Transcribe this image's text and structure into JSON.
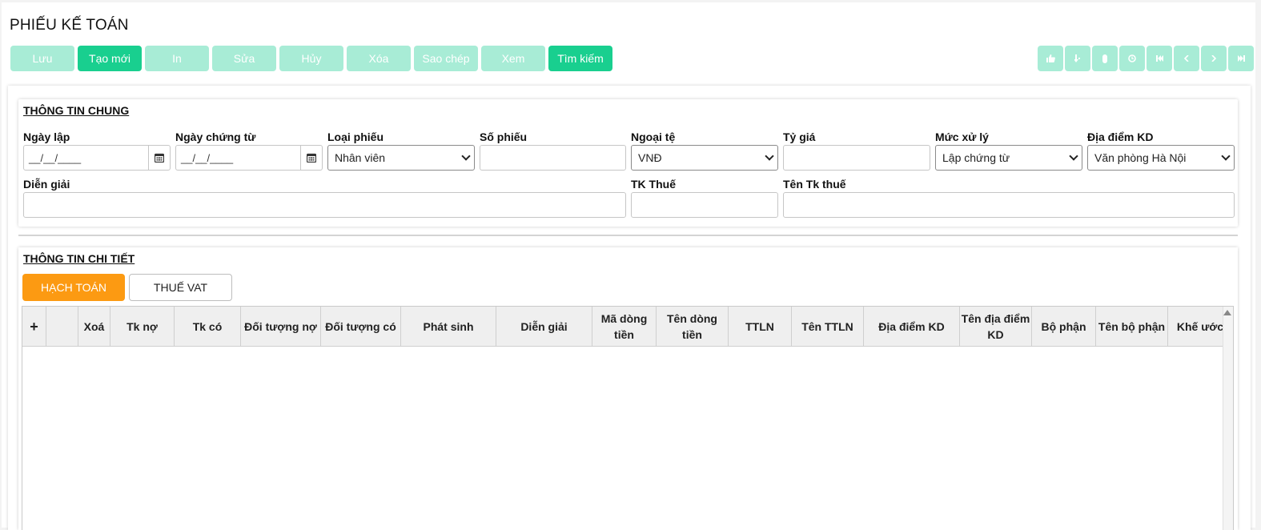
{
  "title": "PHIẾU KẾ TOÁN",
  "toolbar": {
    "save": "Lưu",
    "create": "Tạo mới",
    "print": "In",
    "edit": "Sửa",
    "cancel": "Hủy",
    "delete": "Xóa",
    "copy": "Sao chép",
    "view": "Xem",
    "search": "Tìm kiếm"
  },
  "nav_icons": [
    "thumbs-up-icon",
    "sort-icon",
    "paperclip-icon",
    "history-icon",
    "first-page-icon",
    "prev-icon",
    "next-icon",
    "last-page-icon"
  ],
  "general": {
    "title": "THÔNG TIN CHUNG",
    "date_created_label": "Ngày lập",
    "date_created_placeholder": "__/__/____",
    "doc_date_label": "Ngày chứng từ",
    "doc_date_placeholder": "__/__/____",
    "voucher_type_label": "Loại phiếu",
    "voucher_type_value": "Nhân viên",
    "voucher_no_label": "Số phiếu",
    "voucher_no_value": "",
    "currency_label": "Ngoại tệ",
    "currency_value": "VNĐ",
    "rate_label": "Tỷ giá",
    "rate_value": "",
    "process_label": "Mức xử lý",
    "process_value": "Lập chứng từ",
    "location_label": "Địa điểm KD",
    "location_value": "Văn phòng Hà Nội",
    "description_label": "Diễn giải",
    "description_value": "",
    "tax_account_label": "TK Thuế",
    "tax_account_value": "",
    "tax_account_name_label": "Tên Tk thuế",
    "tax_account_name_value": ""
  },
  "detail": {
    "title": "THÔNG TIN CHI TIẾT",
    "tabs": [
      "HẠCH TOÁN",
      "THUẾ VAT"
    ],
    "columns": [
      "+",
      "",
      "Xoá",
      "Tk nợ",
      "Tk có",
      "Đối tượng nợ",
      "Đối tượng có",
      "Phát sinh",
      "Diễn giải",
      "Mã dòng tiền",
      "Tên dòng tiền",
      "TTLN",
      "Tên TTLN",
      "Địa điểm KD",
      "Tên địa điểm KD",
      "Bộ phận",
      "Tên bộ phận",
      "Khế ước"
    ]
  },
  "colors": {
    "primary": "#19cf8f",
    "primary_disabled": "#a8ecd6",
    "tab_active": "#fc9a12"
  }
}
